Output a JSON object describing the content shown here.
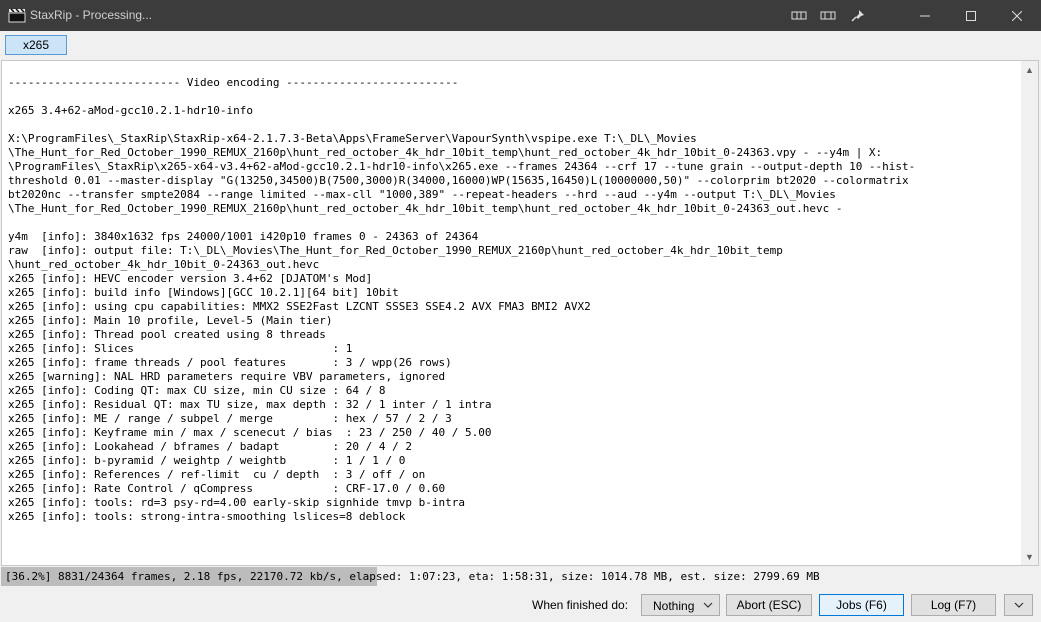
{
  "window": {
    "title": "StaxRip - Processing...",
    "controls": [
      "minimize-icon",
      "maximize-icon",
      "close-icon"
    ]
  },
  "tabs": [
    {
      "label": "x265",
      "active": true
    }
  ],
  "log": {
    "lines": [
      "-------------------------- Video encoding --------------------------",
      "",
      "x265 3.4+62-aMod-gcc10.2.1-hdr10-info",
      "",
      "X:\\ProgramFiles\\_StaxRip\\StaxRip-x64-2.1.7.3-Beta\\Apps\\FrameServer\\VapourSynth\\vspipe.exe T:\\_DL\\_Movies",
      "\\The_Hunt_for_Red_October_1990_REMUX_2160p\\hunt_red_october_4k_hdr_10bit_temp\\hunt_red_october_4k_hdr_10bit_0-24363.vpy - --y4m | X:",
      "\\ProgramFiles\\_StaxRip\\x265-x64-v3.4+62-aMod-gcc10.2.1-hdr10-info\\x265.exe --frames 24364 --crf 17 --tune grain --output-depth 10 --hist-",
      "threshold 0.01 --master-display \"G(13250,34500)B(7500,3000)R(34000,16000)WP(15635,16450)L(10000000,50)\" --colorprim bt2020 --colormatrix",
      "bt2020nc --transfer smpte2084 --range limited --max-cll \"1000,389\" --repeat-headers --hrd --aud --y4m --output T:\\_DL\\_Movies",
      "\\The_Hunt_for_Red_October_1990_REMUX_2160p\\hunt_red_october_4k_hdr_10bit_temp\\hunt_red_october_4k_hdr_10bit_0-24363_out.hevc -",
      "",
      "y4m  [info]: 3840x1632 fps 24000/1001 i420p10 frames 0 - 24363 of 24364",
      "raw  [info]: output file: T:\\_DL\\_Movies\\The_Hunt_for_Red_October_1990_REMUX_2160p\\hunt_red_october_4k_hdr_10bit_temp",
      "\\hunt_red_october_4k_hdr_10bit_0-24363_out.hevc",
      "x265 [info]: HEVC encoder version 3.4+62 [DJATOM's Mod]",
      "x265 [info]: build info [Windows][GCC 10.2.1][64 bit] 10bit",
      "x265 [info]: using cpu capabilities: MMX2 SSE2Fast LZCNT SSSE3 SSE4.2 AVX FMA3 BMI2 AVX2",
      "x265 [info]: Main 10 profile, Level-5 (Main tier)",
      "x265 [info]: Thread pool created using 8 threads",
      "x265 [info]: Slices                              : 1",
      "x265 [info]: frame threads / pool features       : 3 / wpp(26 rows)",
      "x265 [warning]: NAL HRD parameters require VBV parameters, ignored",
      "x265 [info]: Coding QT: max CU size, min CU size : 64 / 8",
      "x265 [info]: Residual QT: max TU size, max depth : 32 / 1 inter / 1 intra",
      "x265 [info]: ME / range / subpel / merge         : hex / 57 / 2 / 3",
      "x265 [info]: Keyframe min / max / scenecut / bias  : 23 / 250 / 40 / 5.00",
      "x265 [info]: Lookahead / bframes / badapt        : 20 / 4 / 2",
      "x265 [info]: b-pyramid / weightp / weightb       : 1 / 1 / 0",
      "x265 [info]: References / ref-limit  cu / depth  : 3 / off / on",
      "x265 [info]: Rate Control / qCompress            : CRF-17.0 / 0.60",
      "x265 [info]: tools: rd=3 psy-rd=4.00 early-skip signhide tmvp b-intra",
      "x265 [info]: tools: strong-intra-smoothing lslices=8 deblock"
    ]
  },
  "status": {
    "text": "[36.2%] 8831/24364 frames, 2.18 fps, 22170.72 kb/s, elapsed: 1:07:23, eta: 1:58:31, size: 1014.78 MB, est. size: 2799.69 MB",
    "progress": 0.362
  },
  "footer": {
    "when_finished_label": "When finished do:",
    "when_finished_value": "Nothing",
    "abort_label": "Abort (ESC)",
    "jobs_label": "Jobs (F6)",
    "log_label": "Log (F7)"
  },
  "colors": {
    "titlebar": "#3c3c3c",
    "accent": "#0078d7",
    "progress": "#bcbcbc"
  }
}
